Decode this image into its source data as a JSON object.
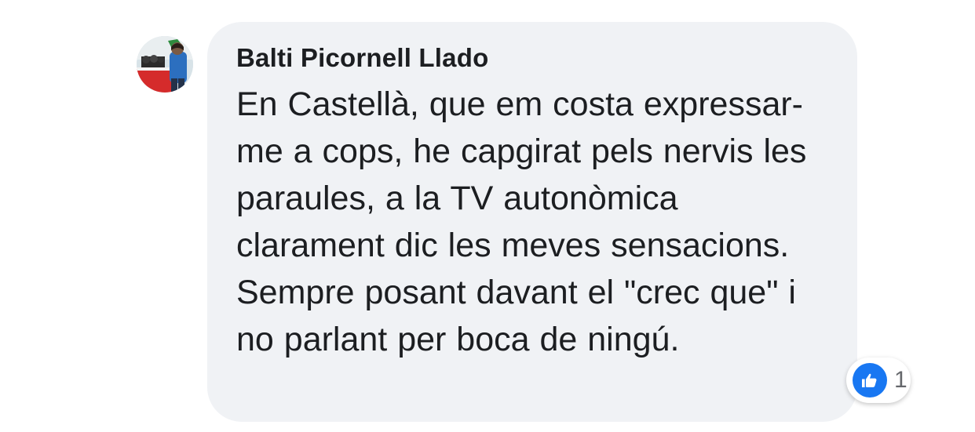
{
  "comment": {
    "author": "Balti Picornell Llado",
    "text": "En Castellà,  que em costa expressar-me a cops, he capgirat pels nervis les paraules,  a la TV autonòmica clarament dic les meves sensacions. Sempre posant davant el \"crec que\" i no parlant per boca de ningú.",
    "reactions": {
      "icon": "thumbs-up-icon",
      "count": "1",
      "color": "#1877f2"
    }
  },
  "colors": {
    "bubble": "#f0f2f5",
    "text": "#1c1e21",
    "muted": "#65676b"
  }
}
